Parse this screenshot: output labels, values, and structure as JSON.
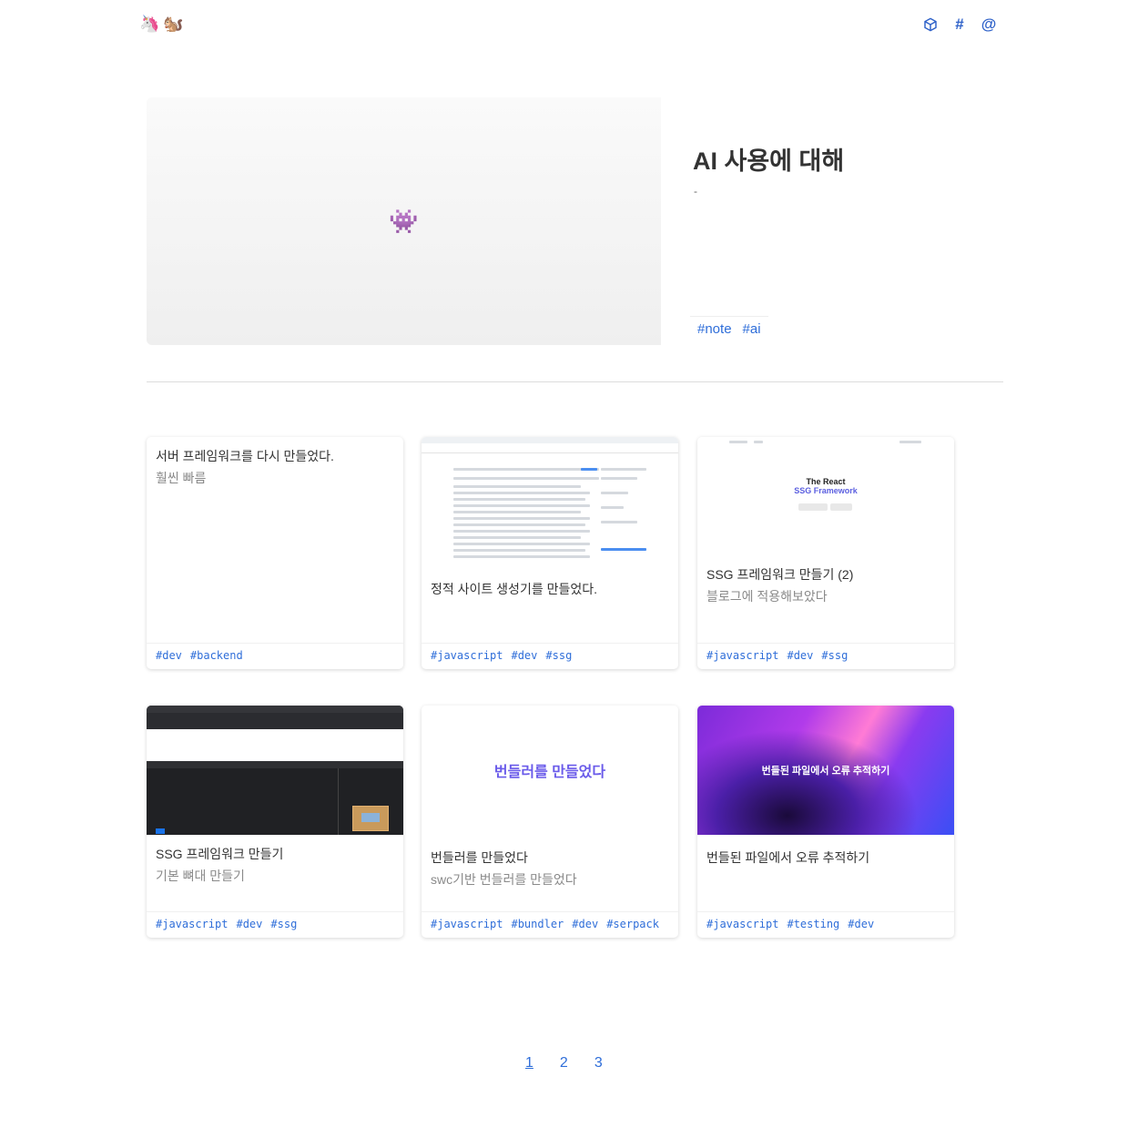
{
  "header": {
    "logo": [
      "🦄",
      "🐿️"
    ],
    "nav": [
      {
        "icon": "box-icon",
        "label": ""
      },
      {
        "icon": "hash-icon",
        "label": "#"
      },
      {
        "icon": "at-icon",
        "label": "@"
      }
    ]
  },
  "featured": {
    "thumb_emoji": "👾",
    "title": "AI 사용에 대해",
    "description": "-",
    "tags": [
      "#note",
      "#ai"
    ]
  },
  "cards": [
    {
      "title": "서버 프레임워크를 다시 만들었다.",
      "subtitle": "훨씬 빠름",
      "tags": [
        "#dev",
        "#backend"
      ]
    },
    {
      "title": "정적 사이트 생성기를 만들었다.",
      "subtitle": "",
      "tags": [
        "#javascript",
        "#dev",
        "#ssg"
      ]
    },
    {
      "title": "SSG 프레임워크 만들기 (2)",
      "subtitle": "블로그에 적용해보았다",
      "tags": [
        "#javascript",
        "#dev",
        "#ssg"
      ],
      "thumb_text": {
        "line1": "The React",
        "line2": "SSG Framework"
      }
    },
    {
      "title": "SSG 프레임워크 만들기",
      "subtitle": "기본 뼈대 만들기",
      "tags": [
        "#javascript",
        "#dev",
        "#ssg"
      ]
    },
    {
      "title": "번들러를 만들었다",
      "subtitle": "swc기반 번들러를 만들었다",
      "tags": [
        "#javascript",
        "#bundler",
        "#dev",
        "#serpack"
      ],
      "thumb_text": "번들러를 만들었다"
    },
    {
      "title": "번들된 파일에서 오류 추적하기",
      "subtitle": "",
      "tags": [
        "#javascript",
        "#testing",
        "#dev"
      ],
      "thumb_text": "번들된 파일에서 오류 추적하기"
    }
  ],
  "pagination": {
    "pages": [
      "1",
      "2",
      "3"
    ],
    "current": "1"
  },
  "colors": {
    "accent": "#2f6ed9",
    "nav": "#2f62c9",
    "divider": "#dcdcdc"
  }
}
